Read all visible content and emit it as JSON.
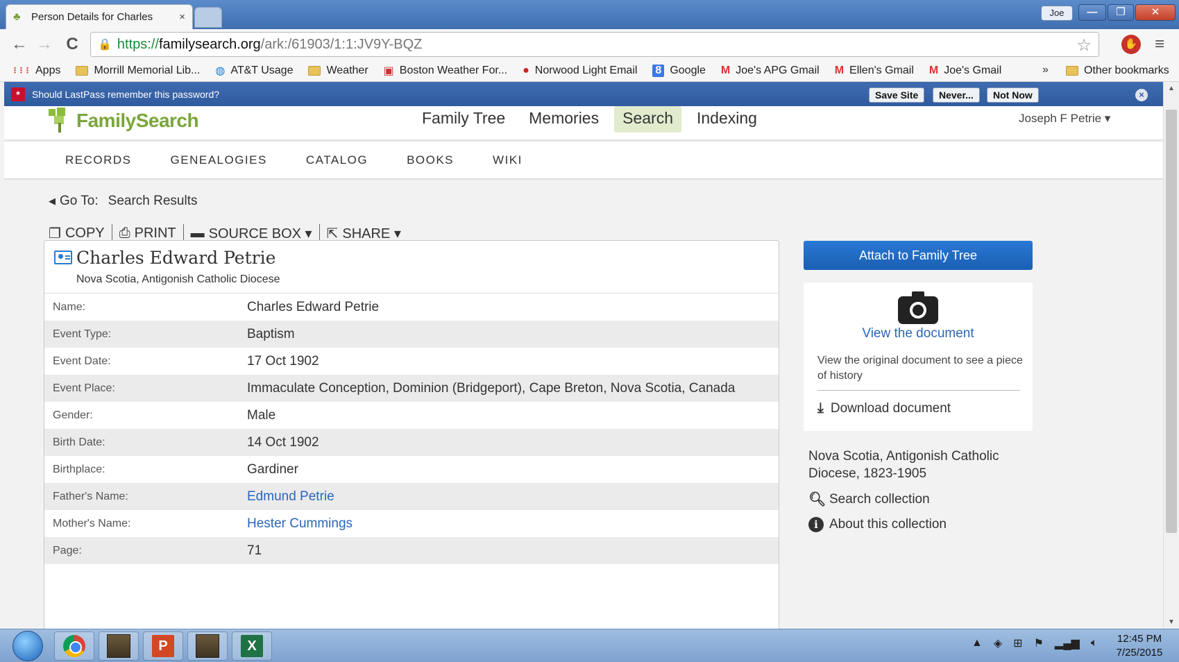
{
  "browser": {
    "tab_title": "Person Details for Charles",
    "tab_close": "×",
    "user_badge": "Joe",
    "win_min": "—",
    "win_max": "❐",
    "win_close": "✕",
    "back": "←",
    "forward": "→",
    "reload": "C",
    "url_scheme": "https://",
    "url_host": "familysearch.org",
    "url_path": "/ark:/61903/1:1:JV9Y-BQZ",
    "star": "☆",
    "menu": "≡"
  },
  "bookmarks": {
    "items": [
      {
        "icon": "apps-icon",
        "label": "Apps"
      },
      {
        "icon": "folder-icon",
        "label": "Morrill Memorial Lib..."
      },
      {
        "icon": "att-icon",
        "label": "AT&T Usage"
      },
      {
        "icon": "folder-icon",
        "label": "Weather"
      },
      {
        "icon": "news-icon",
        "label": "Boston Weather For..."
      },
      {
        "icon": "mail-icon",
        "label": "Norwood Light Email"
      },
      {
        "icon": "google-icon",
        "label": "Google"
      },
      {
        "icon": "gmail-icon",
        "label": "Joe's APG Gmail"
      },
      {
        "icon": "gmail-icon",
        "label": "Ellen's Gmail"
      },
      {
        "icon": "gmail-icon",
        "label": "Joe's Gmail"
      }
    ],
    "more": "»",
    "other": "Other bookmarks"
  },
  "lastpass": {
    "message": "Should LastPass remember this password?",
    "save": "Save Site",
    "never": "Never...",
    "not_now": "Not Now",
    "close": "×"
  },
  "site": {
    "logo_text": "FamilySearch",
    "nav": [
      "Family Tree",
      "Memories",
      "Search",
      "Indexing"
    ],
    "active_nav": "Search",
    "user": "Joseph F Petrie ▾",
    "subnav": [
      "RECORDS",
      "GENEALOGIES",
      "CATALOG",
      "BOOKS",
      "WIKI"
    ]
  },
  "goto": {
    "label": "Go To:",
    "link": "Search Results"
  },
  "actions": {
    "copy": "COPY",
    "print": "PRINT",
    "source_box": "SOURCE BOX ▾",
    "share": "SHARE ▾"
  },
  "record": {
    "name": "Charles Edward Petrie",
    "collection": "Nova Scotia, Antigonish Catholic Diocese",
    "rows": [
      {
        "label": "Name:",
        "value": "Charles Edward Petrie",
        "link": false
      },
      {
        "label": "Event Type:",
        "value": "Baptism",
        "link": false
      },
      {
        "label": "Event Date:",
        "value": "17 Oct 1902",
        "link": false
      },
      {
        "label": "Event Place:",
        "value": "Immaculate Conception, Dominion (Bridgeport), Cape Breton, Nova Scotia, Canada",
        "link": false
      },
      {
        "label": "Gender:",
        "value": "Male",
        "link": false
      },
      {
        "label": "Birth Date:",
        "value": "14 Oct 1902",
        "link": false
      },
      {
        "label": "Birthplace:",
        "value": "Gardiner",
        "link": false
      },
      {
        "label": "Father's Name:",
        "value": "Edmund Petrie",
        "link": true
      },
      {
        "label": "Mother's Name:",
        "value": "Hester Cummings",
        "link": true
      },
      {
        "label": "Page:",
        "value": "71",
        "link": false
      }
    ]
  },
  "sidebar": {
    "attach": "Attach to Family Tree",
    "view_doc": "View the document",
    "doc_desc": "View the original document to see a piece of history",
    "download": "Download document",
    "collection_name": "Nova Scotia, Antigonish Catholic Diocese, 1823-1905",
    "search_collection": "Search collection",
    "about_collection": "About this collection"
  },
  "taskbar": {
    "time": "12:45 PM",
    "date": "7/25/2015"
  }
}
